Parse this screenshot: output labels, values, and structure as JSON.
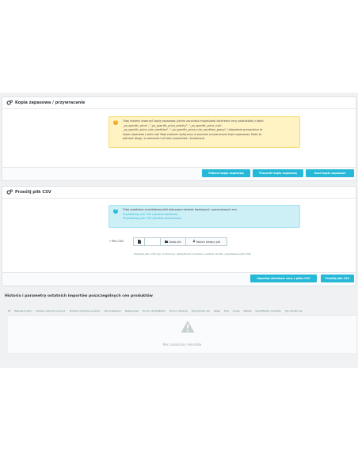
{
  "backup_panel": {
    "title": "Kopia zapasowa / przywracanie",
    "alert_lines": [
      "Tutaj możesz utworzyć kopię zapasową (zanim zaczniesz importować konkretne ceny produktów) z tabel",
      "_ps_specific_price\", \"_ps_specific_price_priority\", \"_ps_specific_price_rule\",",
      "_ps_specific_price_rule_condition\", \"_ps_specific_price_rule_condition_group\". Ustawienie przywrócisz te",
      "kopie zapasowe z pliku sql! Błąd zostanie wyłączony w procesie przywracania kopii zapasowej. Może to",
      "potrwać długo, w zależności od ilości produktów i kombinacji."
    ],
    "buttons": {
      "download": "Pobierz kopię zapasową",
      "restore": "Przywróć kopię zapasową",
      "delete": "Usuń kopie zapasowe"
    }
  },
  "csv_panel": {
    "title": "Prześlij plik CSV",
    "info_text": "Tutaj znajdziesz przykładowe pliki dotyczące obniżek kwotowych i procentowych cen",
    "info_links": [
      "Przykładowy plik CSV (obniżka kwotowa)",
      "Przykładowy plik CSV (obniżka procentowa)"
    ],
    "file_label": "Plik CSV:",
    "file_required_mark": "*",
    "file_buttons": {
      "add": "Dodaj plik",
      "download_existing": "Pobierz bieżący plik"
    },
    "help_text": "Przykład pliku CSV (np. Z kolumną: identyfikator produktu, wartość obniżki, przykładowa plik CSV)",
    "buttons": {
      "import": "Importuj określone ceny z pliku CSV",
      "upload": "Prześlij plik CSV"
    }
  },
  "history": {
    "title": "Historia i parametry ostatnich importów poszczególnych cen produktów",
    "columns": [
      "ID",
      "Wiersze w pliku",
      "Dodano redukcje na prod.",
      "Dodano redukcje na komb.",
      "Nie znaleziono",
      "Nazwa pliku",
      "Po kol. identyfikator",
      "Po kol. redukcje",
      "Typ importu cen",
      "Sklep",
      "Kraj",
      "Grupa",
      "Waluta",
      "Identyfikator produktu",
      "Typ obniżki cen"
    ],
    "empty_message": "Nie znaleziono rekordów"
  },
  "colors": {
    "primary": "#25b9d7",
    "warning_bg": "#fff3c4",
    "warning_icon": "#f5a623",
    "info_bg": "#cdeff6",
    "info_icon": "#25b9d7"
  }
}
